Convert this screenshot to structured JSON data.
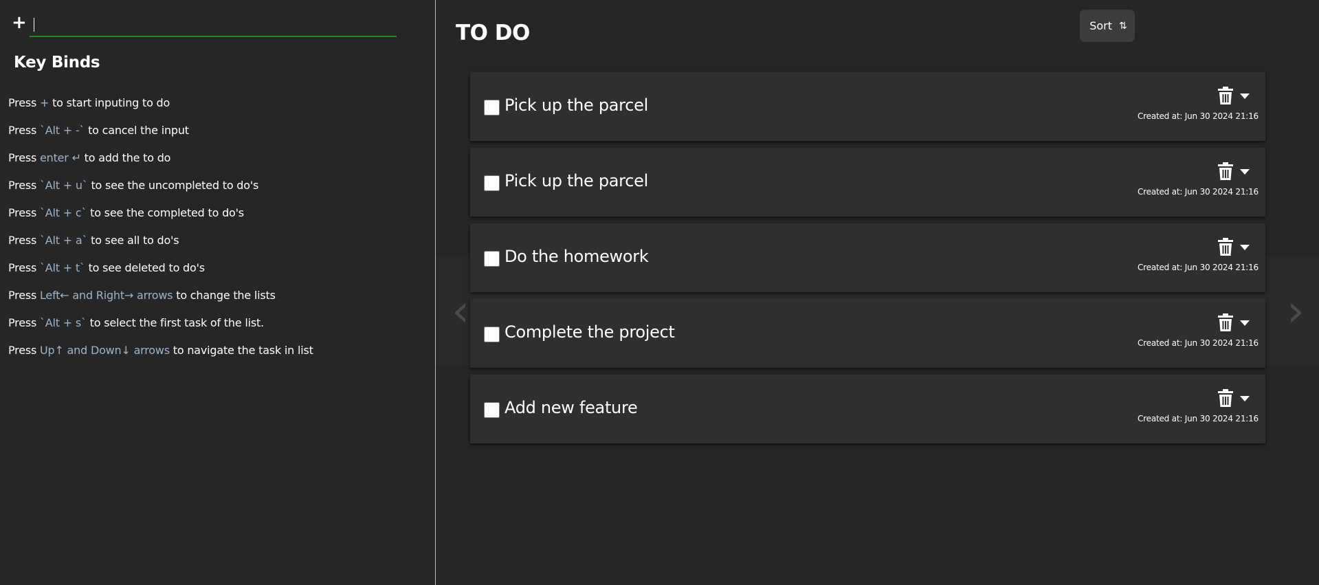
{
  "left": {
    "add_symbol": "+",
    "input_value": "",
    "input_placeholder": "",
    "keybinds_title": "Key Binds",
    "keybinds": [
      {
        "pre": "Press ",
        "key": "+",
        "post": " to start inputing to do"
      },
      {
        "pre": "Press ",
        "key": "`Alt + -`",
        "post": " to cancel the input"
      },
      {
        "pre": "Press ",
        "key": "enter ↵",
        "post": " to add the to do"
      },
      {
        "pre": "Press ",
        "key": "`Alt + u`",
        "post": " to see the uncompleted to do's"
      },
      {
        "pre": "Press ",
        "key": "`Alt + c`",
        "post": " to see the completed to do's"
      },
      {
        "pre": "Press ",
        "key": "`Alt + a`",
        "post": " to see all to do's"
      },
      {
        "pre": "Press ",
        "key": "`Alt + t`",
        "post": " to see deleted to do's"
      },
      {
        "pre": "Press ",
        "key": "Left← and Right→ arrows",
        "post": " to change the lists"
      },
      {
        "pre": "Press ",
        "key": "`Alt + s`",
        "post": " to select the first task of the list."
      },
      {
        "pre": "Press ",
        "key": "Up↑ and Down↓ arrows",
        "post": " to navigate the task in list"
      }
    ]
  },
  "main": {
    "title": "TO DO",
    "sort_label": "Sort",
    "sort_icon": "⇅",
    "nav_prev_icon": "‹",
    "nav_next_icon": "›",
    "tasks": [
      {
        "title": "Pick up the parcel",
        "created": "Created at: Jun 30 2024 21:16",
        "checked": false
      },
      {
        "title": "Pick up the parcel",
        "created": "Created at: Jun 30 2024 21:16",
        "checked": false
      },
      {
        "title": "Do the homework",
        "created": "Created at: Jun 30 2024 21:16",
        "checked": false
      },
      {
        "title": "Complete the project",
        "created": "Created at: Jun 30 2024 21:16",
        "checked": false
      },
      {
        "title": "Add new feature",
        "created": "Created at: Jun 30 2024 21:16",
        "checked": false
      }
    ]
  },
  "colors": {
    "background": "#262626",
    "card": "#2f2f2f",
    "input_underline": "#1a8c1a",
    "key_highlight": "#9fb3c8",
    "sort_button": "#3c3c3c"
  },
  "icons": {
    "add": "plus-icon",
    "sort": "sort-arrows-icon",
    "trash": "trash-icon",
    "expand": "chevron-down-icon",
    "prev": "chevron-left-icon",
    "next": "chevron-right-icon"
  }
}
